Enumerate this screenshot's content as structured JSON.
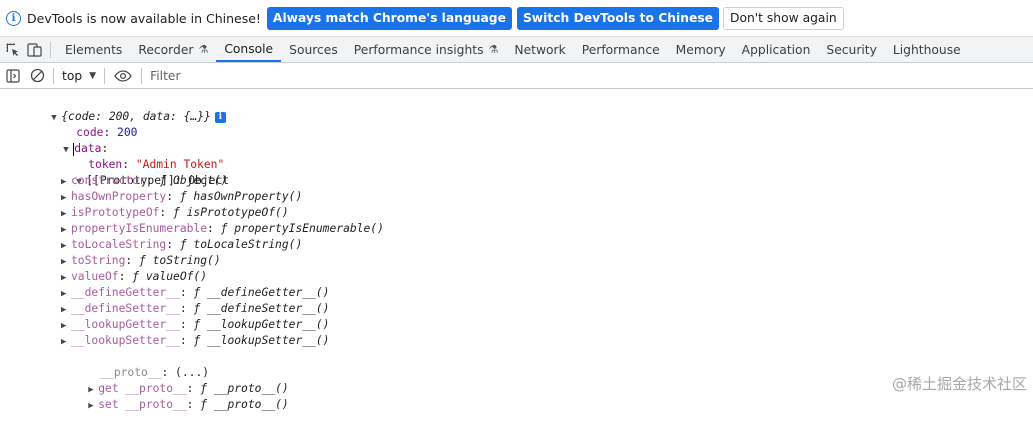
{
  "infobar": {
    "message": "DevTools is now available in Chinese!",
    "btn_match": "Always match Chrome's language",
    "btn_switch": "Switch DevTools to Chinese",
    "btn_dismiss": "Don't show again"
  },
  "tabs": {
    "elements": "Elements",
    "recorder": "Recorder",
    "console": "Console",
    "sources": "Sources",
    "performance_insights": "Performance insights",
    "network": "Network",
    "performance": "Performance",
    "memory": "Memory",
    "application": "Application",
    "security": "Security",
    "lighthouse": "Lighthouse"
  },
  "toolbar": {
    "context": "top",
    "filter_placeholder": "Filter"
  },
  "console": {
    "summary": "{code: 200, data: {…}}",
    "code_key": "code",
    "code_value": "200",
    "data_key": "data",
    "token_key": "token",
    "token_value": "\"Admin Token\"",
    "proto_key": "[[Prototype]]",
    "proto_value": "Object",
    "proto_members": [
      {
        "key": "constructor",
        "value": "ƒ Object()"
      },
      {
        "key": "hasOwnProperty",
        "value": "ƒ hasOwnProperty()"
      },
      {
        "key": "isPrototypeOf",
        "value": "ƒ isPrototypeOf()"
      },
      {
        "key": "propertyIsEnumerable",
        "value": "ƒ propertyIsEnumerable()"
      },
      {
        "key": "toLocaleString",
        "value": "ƒ toLocaleString()"
      },
      {
        "key": "toString",
        "value": "ƒ toString()"
      },
      {
        "key": "valueOf",
        "value": "ƒ valueOf()"
      },
      {
        "key": "__defineGetter__",
        "value": "ƒ __defineGetter__()"
      },
      {
        "key": "__defineSetter__",
        "value": "ƒ __defineSetter__()"
      },
      {
        "key": "__lookupGetter__",
        "value": "ƒ __lookupGetter__()"
      },
      {
        "key": "__lookupSetter__",
        "value": "ƒ __lookupSetter__()"
      }
    ],
    "proto_accessor": {
      "key": "__proto__",
      "value": "(...)"
    },
    "getter": {
      "key": "get __proto__",
      "value": "ƒ __proto__()"
    },
    "setter": {
      "key": "set __proto__",
      "value": "ƒ __proto__()"
    }
  },
  "watermark": "@稀土掘金技术社区",
  "colors": {
    "accent": "#1a73e8",
    "property_key": "#881280",
    "number": "#1a1aa6",
    "string": "#c41a16"
  }
}
